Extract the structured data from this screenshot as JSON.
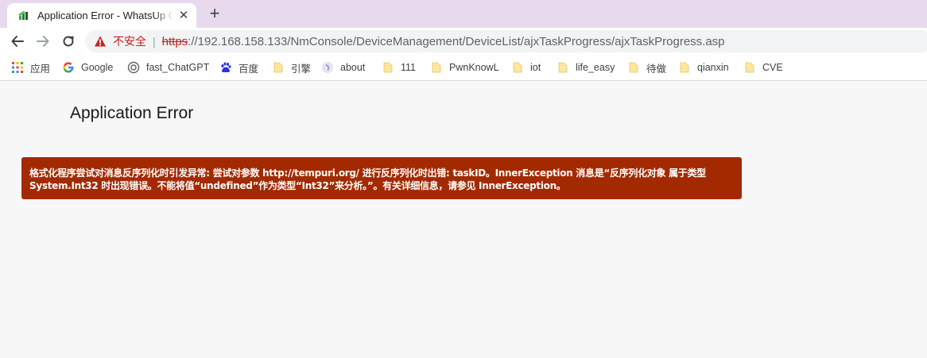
{
  "tab": {
    "title": "Application Error - WhatsUp Gold",
    "close": "✕"
  },
  "new_tab": "+",
  "address_bar": {
    "security_label": "不安全",
    "separator": "|",
    "protocol": "https",
    "url_rest": "://192.168.158.133/NmConsole/DeviceManagement/DeviceList/ajxTaskProgress/ajxTaskProgress.asp"
  },
  "bookmarks": [
    {
      "label": "应用",
      "icon": "apps-grid-icon"
    },
    {
      "label": "Google",
      "icon": "google-icon"
    },
    {
      "label": "fast_ChatGPT",
      "icon": "chatgpt-icon"
    },
    {
      "label": "百度",
      "icon": "baidu-icon"
    },
    {
      "label": "引擎",
      "icon": "folder-icon"
    },
    {
      "label": "about",
      "icon": "about-icon"
    },
    {
      "label": "111",
      "icon": "folder-icon"
    },
    {
      "label": "PwnKnowL",
      "icon": "folder-icon"
    },
    {
      "label": "iot",
      "icon": "folder-icon"
    },
    {
      "label": "life_easy",
      "icon": "folder-icon"
    },
    {
      "label": "待做",
      "icon": "folder-icon"
    },
    {
      "label": "qianxin",
      "icon": "folder-icon"
    },
    {
      "label": "CVE",
      "icon": "folder-icon"
    }
  ],
  "page": {
    "heading": "Application Error",
    "error_line1": "格式化程序尝试对消息反序列化时引发异常: 尝试对参数 http://tempuri.org/ 进行反序列化时出错: taskID。InnerException 消息是“反序列化对象 属于类型",
    "error_line2": "System.Int32 时出现错误。不能将值“undefined”作为类型“Int32”来分析。”。有关详细信息，请参见 InnerException。"
  },
  "colors": {
    "tabstrip": "#e8d9ee",
    "error_background": "#a32a00",
    "insecure_red": "#c5221f",
    "page_background": "#f7f7f7"
  }
}
